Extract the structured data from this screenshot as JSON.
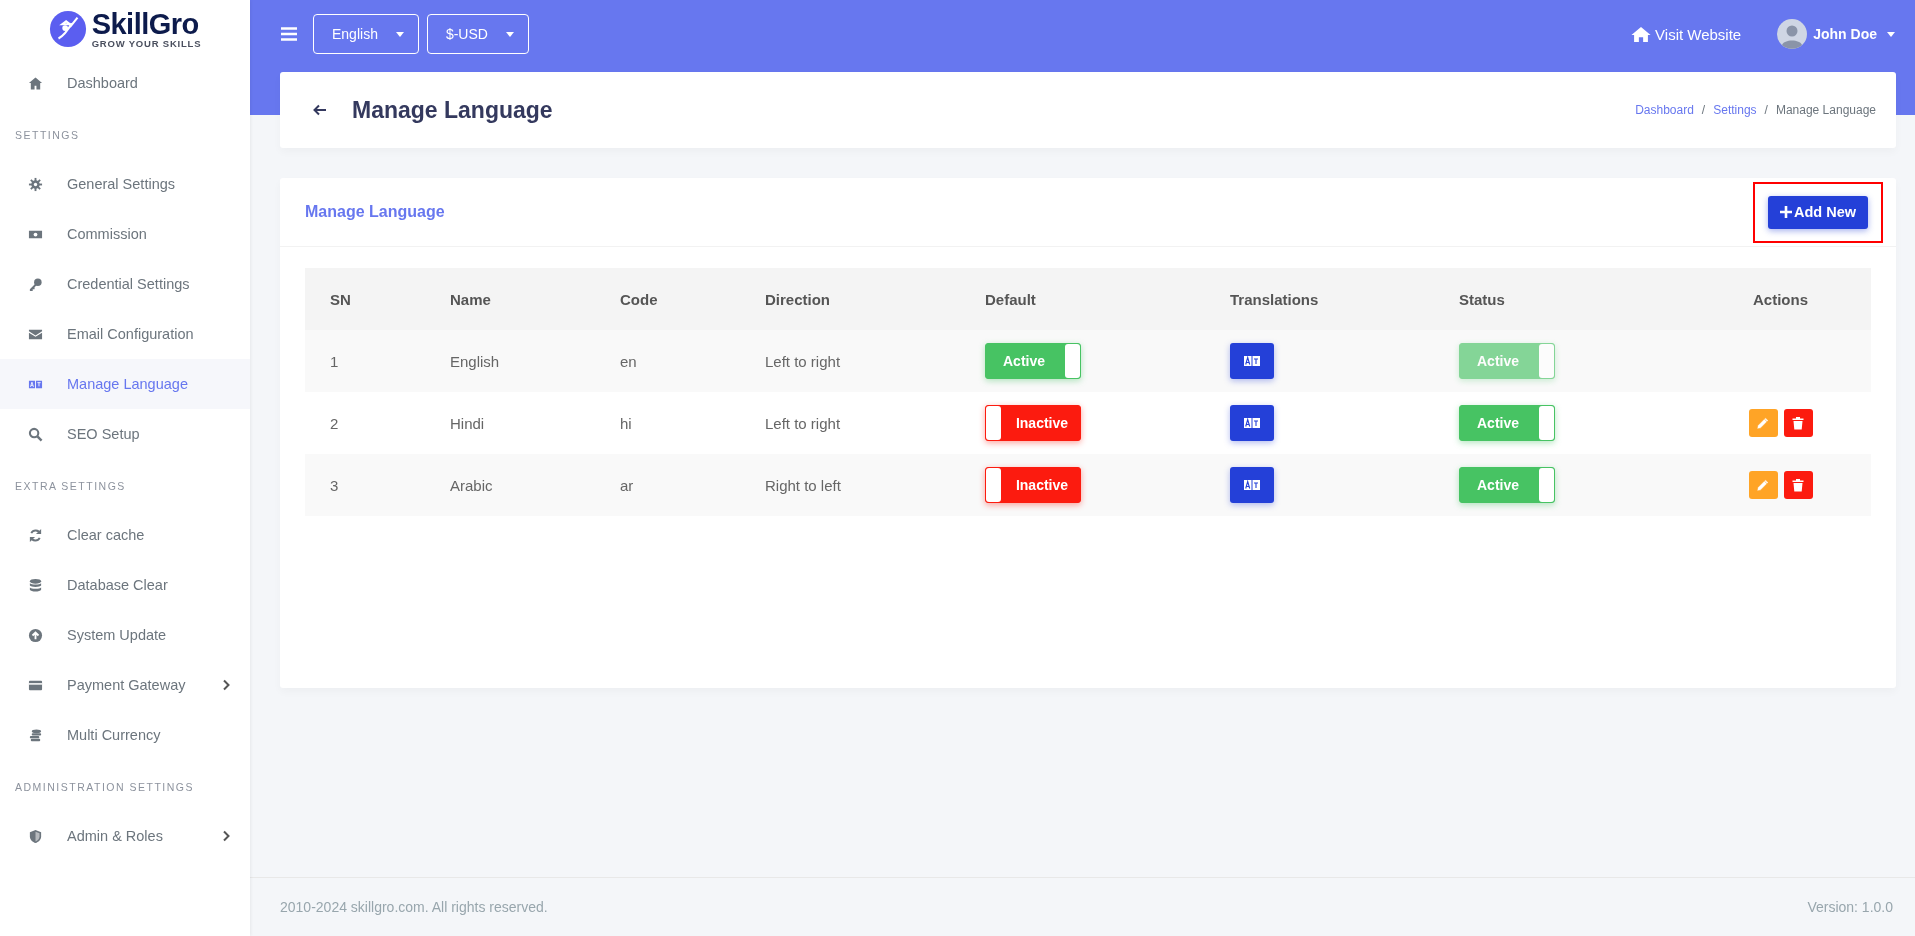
{
  "logo": {
    "name": "SkillGro",
    "tagline": "GROW YOUR SKILLS"
  },
  "sidebar": {
    "groups": [
      {
        "items": [
          {
            "label": "Dashboard",
            "selected": false,
            "has_submenu": false
          }
        ]
      },
      {
        "heading": "SETTINGS",
        "items": [
          {
            "label": "General Settings",
            "selected": false,
            "has_submenu": false
          },
          {
            "label": "Commission",
            "selected": false,
            "has_submenu": false
          },
          {
            "label": "Credential Settings",
            "selected": false,
            "has_submenu": false
          },
          {
            "label": "Email Configuration",
            "selected": false,
            "has_submenu": false
          },
          {
            "label": "Manage Language",
            "selected": true,
            "has_submenu": false
          },
          {
            "label": "SEO Setup",
            "selected": false,
            "has_submenu": false
          }
        ]
      },
      {
        "heading": "EXTRA SETTINGS",
        "items": [
          {
            "label": "Clear cache",
            "selected": false,
            "has_submenu": false
          },
          {
            "label": "Database Clear",
            "selected": false,
            "has_submenu": false
          },
          {
            "label": "System Update",
            "selected": false,
            "has_submenu": false
          },
          {
            "label": "Payment Gateway",
            "selected": false,
            "has_submenu": true
          },
          {
            "label": "Multi Currency",
            "selected": false,
            "has_submenu": false
          }
        ]
      },
      {
        "heading": "ADMINISTRATION SETTINGS",
        "items": [
          {
            "label": "Admin & Roles",
            "selected": false,
            "has_submenu": true
          }
        ]
      }
    ]
  },
  "topbar": {
    "language": "English",
    "currency": "$-USD",
    "visit_website": "Visit Website",
    "user": "John Doe"
  },
  "page_header": {
    "title": "Manage Language",
    "breadcrumbs": [
      {
        "label": "Dashboard",
        "link": true
      },
      {
        "label": "Settings",
        "link": true
      },
      {
        "label": "Manage Language",
        "link": false
      }
    ],
    "separator": "/"
  },
  "card": {
    "title": "Manage Language",
    "add_button": {
      "label": "Add New",
      "highlighted": true
    },
    "table": {
      "columns": [
        "SN",
        "Name",
        "Code",
        "Direction",
        "Default",
        "Translations",
        "Status",
        "Actions"
      ],
      "rows": [
        {
          "sn": "1",
          "name": "English",
          "code": "en",
          "direction": "Left to right",
          "default": {
            "label": "Active",
            "on": true,
            "disabled": false
          },
          "status": {
            "label": "Active",
            "on": true,
            "disabled": true
          }
        },
        {
          "sn": "2",
          "name": "Hindi",
          "code": "hi",
          "direction": "Left to right",
          "default": {
            "label": "Inactive",
            "on": false,
            "disabled": false
          },
          "status": {
            "label": "Active",
            "on": true,
            "disabled": false
          },
          "actions": [
            {
              "kind": "edit"
            },
            {
              "kind": "delete"
            }
          ]
        },
        {
          "sn": "3",
          "name": "Arabic",
          "code": "ar",
          "direction": "Right to left",
          "default": {
            "label": "Inactive",
            "on": false,
            "disabled": false
          },
          "status": {
            "label": "Active",
            "on": true,
            "disabled": false
          },
          "actions": [
            {
              "kind": "edit"
            },
            {
              "kind": "delete"
            }
          ]
        }
      ]
    }
  },
  "footer": {
    "copyright": "2010-2024 skillgro.com. All rights reserved.",
    "version": "Version: 1.0.0"
  }
}
